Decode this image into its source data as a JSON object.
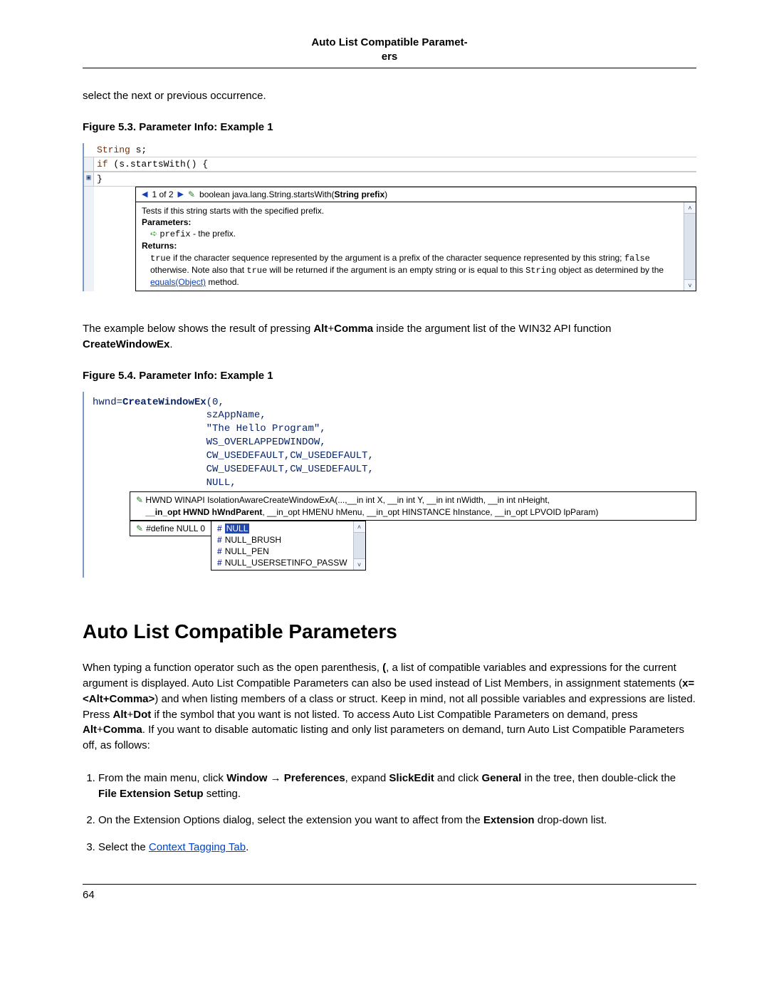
{
  "header_title_line1": "Auto List Compatible Paramet-",
  "header_title_line2": "ers",
  "intro_para": "select the next or previous occurrence.",
  "fig53_caption": "Figure 5.3.  Parameter Info: Example 1",
  "fig53": {
    "line1_kw": "String",
    "line1_rest": " s;",
    "line2_kw": "if",
    "line2_rest": " (s.startsWith() {",
    "line3": "}",
    "sig_counter": "1 of 2",
    "sig_text_prefix": "boolean java.lang.String.startsWith(",
    "sig_text_bold": "String prefix",
    "sig_text_suffix": ")",
    "doc_line1": "Tests if this string starts with the specified prefix.",
    "doc_parameters_label": "Parameters:",
    "doc_param_name": "prefix",
    "doc_param_desc": " - the prefix.",
    "doc_returns_label": "Returns:",
    "doc_returns_1": "true",
    "doc_returns_2": " if the character sequence represented by the argument is a prefix of the character sequence represented by this string; ",
    "doc_returns_3": "false",
    "doc_returns_4": " otherwise. Note also that ",
    "doc_returns_5": "true",
    "doc_returns_6": " will be returned if the argument is an empty string or is equal to this ",
    "doc_returns_7": "String",
    "doc_returns_8": " object as determined by the ",
    "doc_returns_link": "equals(Object)",
    "doc_returns_9": " method."
  },
  "mid_para_1": "The example below shows the result of pressing ",
  "mid_para_bold1": "Alt",
  "mid_para_plus": "+",
  "mid_para_bold2": "Comma",
  "mid_para_2": " inside the argument list of the WIN32 API function ",
  "mid_para_bold3": "CreateWindowEx",
  "mid_para_3": ".",
  "fig54_caption": "Figure 5.4.  Parameter Info: Example 1",
  "fig54": {
    "l1a": "hwnd=",
    "l1b": "CreateWindowEx",
    "l1c": "(0,",
    "l2": "                   szAppName,",
    "l3": "                   \"The Hello Program\",",
    "l4": "                   WS_OVERLAPPEDWINDOW,",
    "l5": "                   CW_USEDEFAULT,CW_USEDEFAULT,",
    "l6": "                   CW_USEDEFAULT,CW_USEDEFAULT,",
    "l7": "                   NULL,",
    "sig_a": "HWND WINAPI IsolationAwareCreateWindowExA(...,__in int X, __in int Y, __in int nWidth, __in int nHeight,",
    "sig_bold": "__in_opt HWND hWndParent",
    "sig_b": ", __in_opt HMENU hMenu, __in_opt HINSTANCE hInstance, __in_opt LPVOID lpParam)",
    "define_text": "#define NULL 0",
    "completion": [
      "NULL",
      "NULL_BRUSH",
      "NULL_PEN",
      "NULL_USERSETINFO_PASSW"
    ]
  },
  "h2": "Auto List Compatible Parameters",
  "body_p1a": "When typing a function operator such as the open parenthesis, ",
  "body_p1b": "(",
  "body_p1c": ", a list of compatible variables and expressions for the current argument is displayed. Auto List Compatible Parameters can also be used instead of List Members, in assignment statements (",
  "body_p1d": "x=<Alt+Comma>",
  "body_p1e": ") and when listing members of a class or struct. Keep in mind, not all possible variables and expressions are listed. Press ",
  "body_p1f": "Alt",
  "body_p1g": "Dot",
  "body_p1h": " if the symbol that you want is not listed. To access Auto List Compatible Parameters on demand, press ",
  "body_p1i": "Comma",
  "body_p1j": ". If you want to disable automatic listing and only list parameters on demand, turn Auto List Compatible Parameters off, as follows:",
  "step1a": "From the main menu, click ",
  "step1b": "Window",
  "step1c": "Preferences",
  "step1d": ", expand ",
  "step1e": "SlickEdit",
  "step1f": " and click ",
  "step1g": "General",
  "step1h": " in the tree, then double-click the ",
  "step1i": "File Extension Setup",
  "step1j": " setting.",
  "step2a": "On the Extension Options dialog, select the extension you want to affect from the ",
  "step2b": "Extension",
  "step2c": " drop-down list.",
  "step3a": "Select the ",
  "step3link": "Context Tagging Tab",
  "step3b": ".",
  "arrow": " → ",
  "page_num": "64"
}
